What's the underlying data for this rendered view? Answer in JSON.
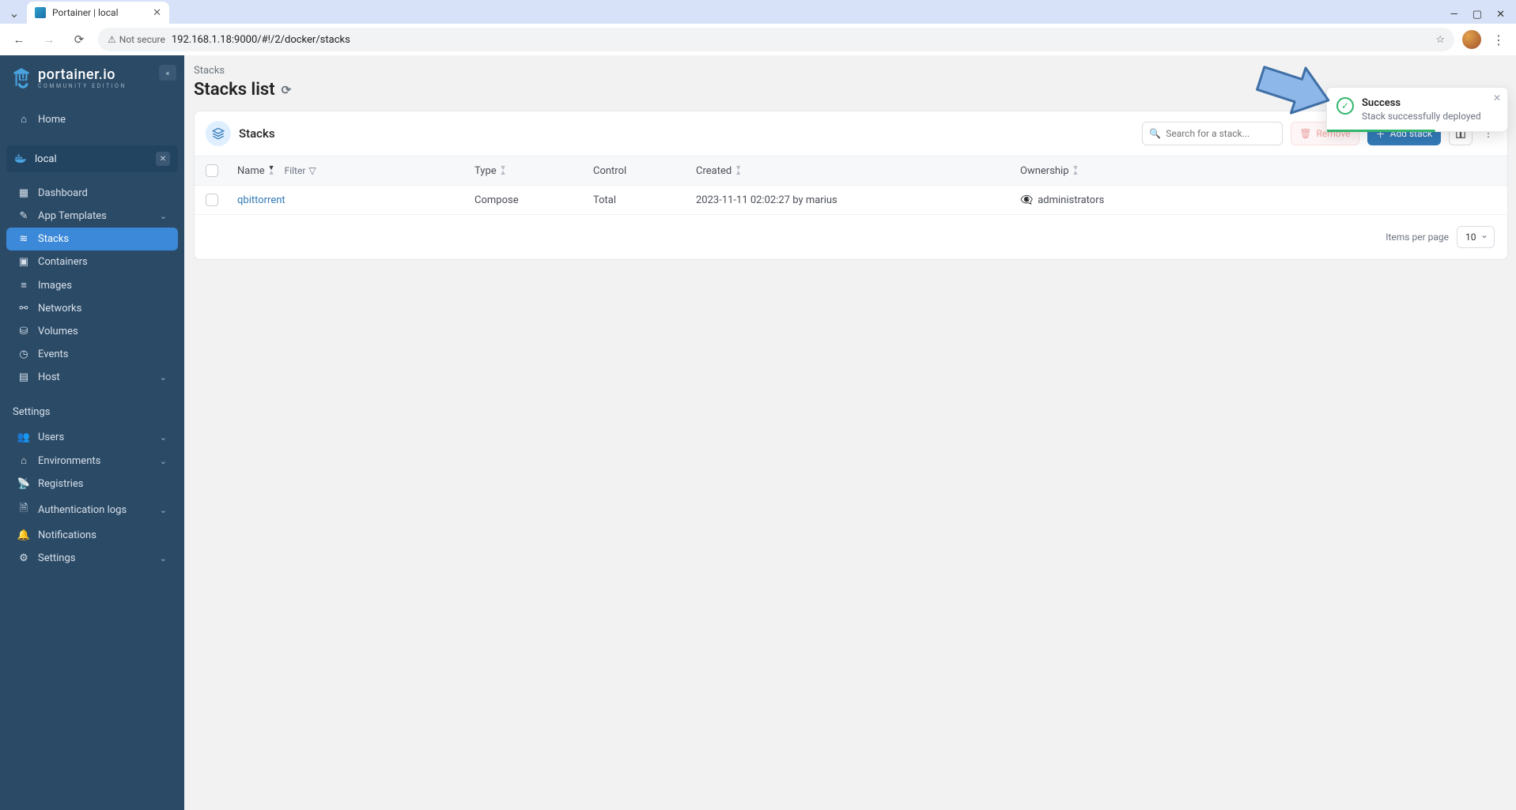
{
  "browser": {
    "tab_title": "Portainer | local",
    "not_secure": "Not secure",
    "url": "192.168.1.18:9000/#!/2/docker/stacks"
  },
  "brand": {
    "name": "portainer.io",
    "edition": "COMMUNITY EDITION"
  },
  "sidebar": {
    "home": "Home",
    "env_label": "local",
    "items": [
      "Dashboard",
      "App Templates",
      "Stacks",
      "Containers",
      "Images",
      "Networks",
      "Volumes",
      "Events",
      "Host"
    ],
    "settings_heading": "Settings",
    "settings_items": [
      "Users",
      "Environments",
      "Registries",
      "Authentication logs",
      "Notifications",
      "Settings"
    ]
  },
  "page": {
    "crumb": "Stacks",
    "title": "Stacks list"
  },
  "panel": {
    "title": "Stacks",
    "search_placeholder": "Search for a stack...",
    "remove_label": "Remove",
    "add_label": "Add stack",
    "columns": {
      "name": "Name",
      "filter": "Filter",
      "type": "Type",
      "control": "Control",
      "created": "Created",
      "ownership": "Ownership"
    },
    "rows": [
      {
        "name": "qbittorrent",
        "type": "Compose",
        "control": "Total",
        "created": "2023-11-11 02:02:27 by marius",
        "ownership": "administrators"
      }
    ],
    "items_per_page_label": "Items per page",
    "items_per_page_value": "10"
  },
  "toast": {
    "title": "Success",
    "message": "Stack successfully deployed"
  }
}
